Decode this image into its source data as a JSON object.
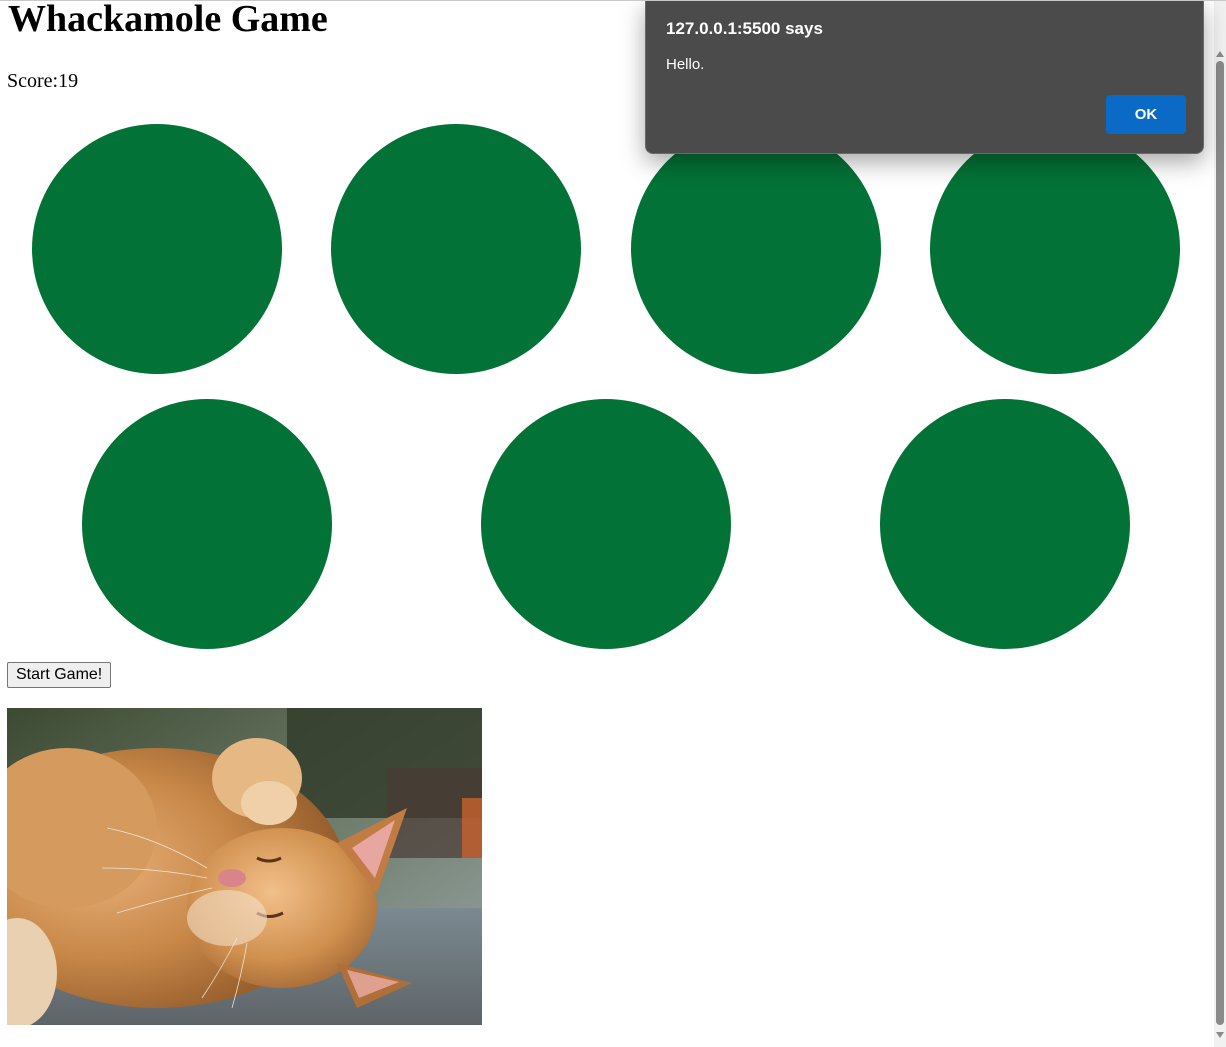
{
  "game": {
    "title": "Whackamole Game",
    "score_label": "Score:",
    "score_value": "19",
    "hole_color": "#037236",
    "start_button_label": "Start Game!"
  },
  "image": {
    "alt": "sleeping ginger cat"
  },
  "alert": {
    "origin": "127.0.0.1:5500 says",
    "message": "Hello.",
    "ok_label": "OK",
    "button_color": "#0b6ac6"
  }
}
